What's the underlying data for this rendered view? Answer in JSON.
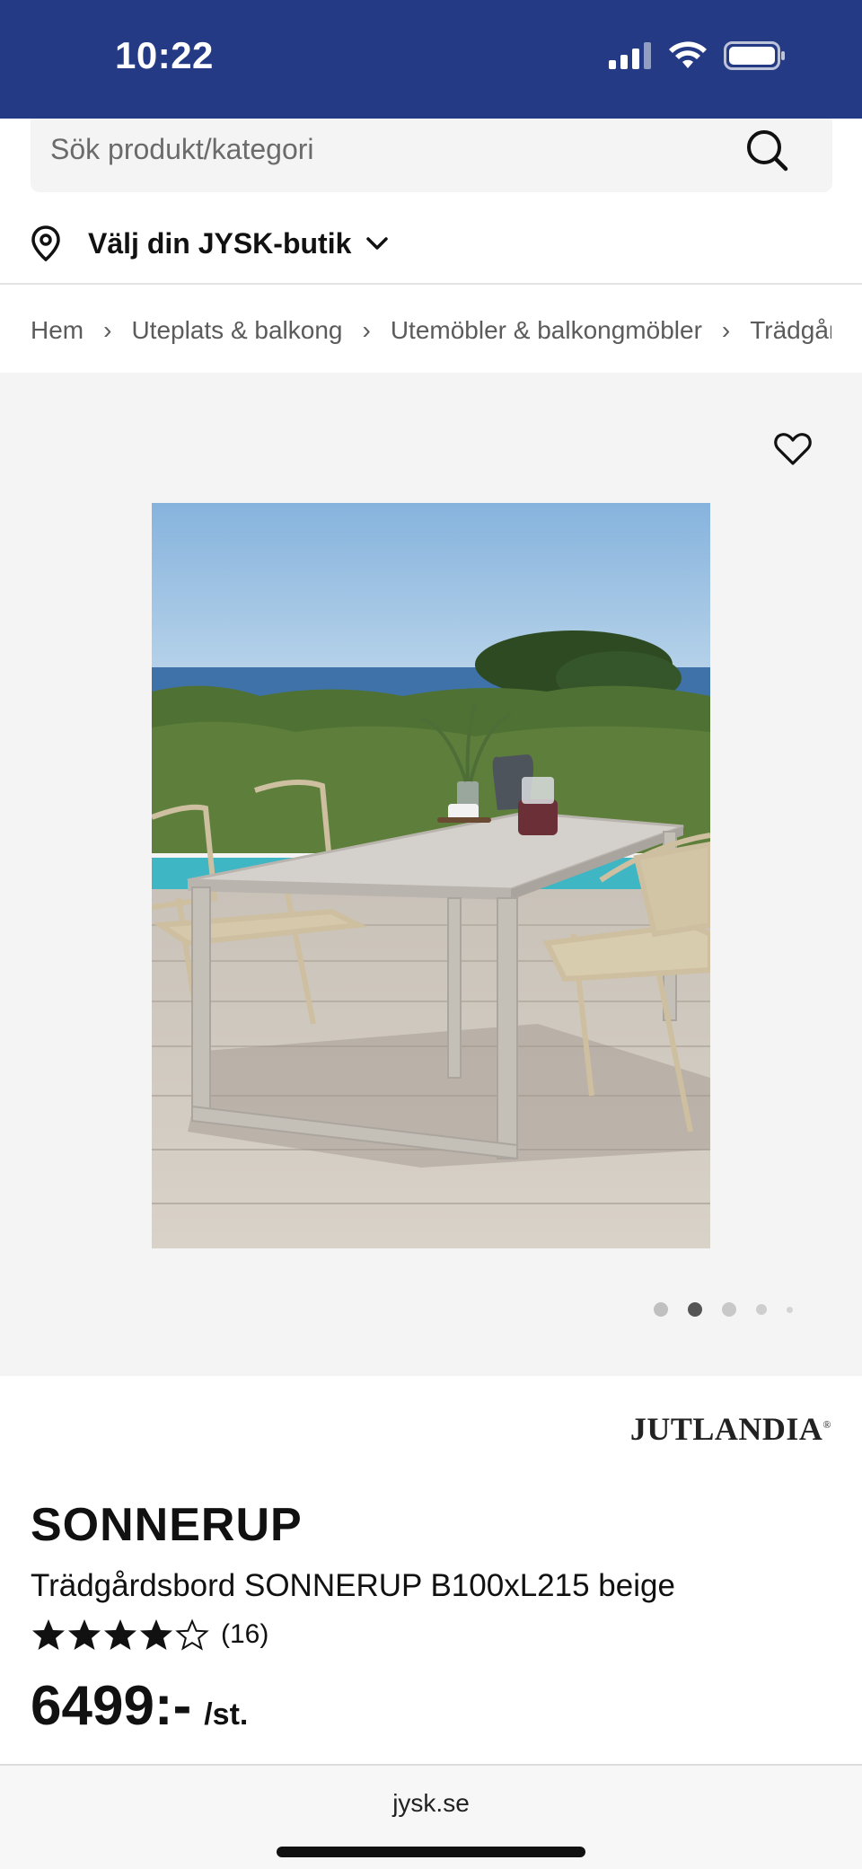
{
  "status_bar": {
    "time": "10:22",
    "icons": [
      "cellular-signal-icon",
      "wifi-icon",
      "battery-icon"
    ]
  },
  "search": {
    "placeholder": "Sök produkt/kategori"
  },
  "store": {
    "label": "Välj din JYSK-butik"
  },
  "breadcrumb": [
    "Hem",
    "Uteplats & balkong",
    "Utemöbler & balkongmöbler",
    "Trädgårdsbord"
  ],
  "gallery": {
    "active_index": 1,
    "dot_count": 5
  },
  "product": {
    "brand": "JUTLANDIA",
    "brand_mark": "®",
    "name": "SONNERUP",
    "description": "Trädgårdsbord SONNERUP B100xL215 beige",
    "rating": 4,
    "rating_max": 5,
    "review_count": "(16)",
    "price": "6499:-",
    "price_unit": "/st."
  },
  "browser": {
    "url": "jysk.se"
  },
  "colors": {
    "header_bg": "#243a84",
    "gallery_bg": "#f4f4f4",
    "search_bg": "#f4f4f4"
  }
}
